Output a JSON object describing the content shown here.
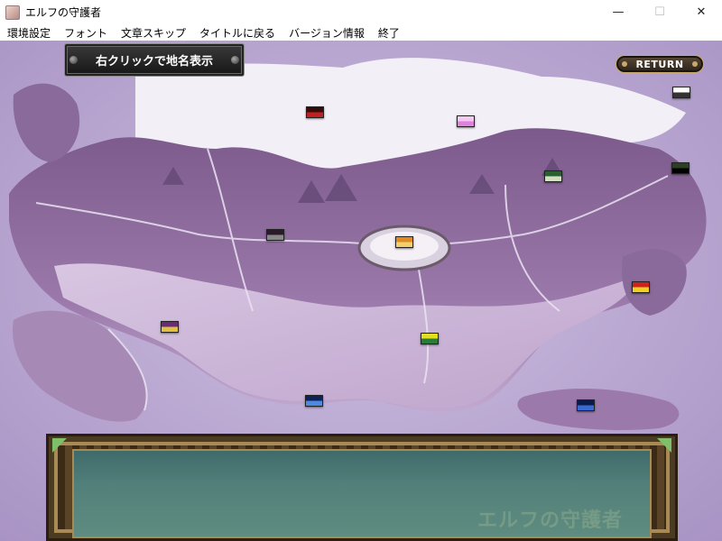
{
  "window": {
    "title": "エルフの守護者",
    "controls": {
      "minimize": "—",
      "maximize": "☐",
      "close": "✕"
    }
  },
  "menu": {
    "items": [
      {
        "label": "環境設定"
      },
      {
        "label": "フォント"
      },
      {
        "label": "文章スキップ"
      },
      {
        "label": "タイトルに戻る"
      },
      {
        "label": "バージョン情報"
      },
      {
        "label": "終了"
      }
    ]
  },
  "map": {
    "hint_label": "右クリックで地名表示",
    "return_label": "RETURN",
    "flags": [
      {
        "name": "flag-north-red",
        "colors": [
          "#3a0a0a",
          "#c02020"
        ]
      },
      {
        "name": "flag-north-pink",
        "colors": [
          "#f4c8f0",
          "#e080e0"
        ]
      },
      {
        "name": "flag-northeast-white",
        "colors": [
          "#ffffff",
          "#333333"
        ]
      },
      {
        "name": "flag-east-green",
        "colors": [
          "#2a6030",
          "#d0e0c0"
        ]
      },
      {
        "name": "flag-east-dark",
        "colors": [
          "#2a4020",
          "#000000"
        ]
      },
      {
        "name": "flag-west-dark",
        "colors": [
          "#2a1a2a",
          "#888888"
        ]
      },
      {
        "name": "flag-center-orange",
        "colors": [
          "#e08a20",
          "#f0d070"
        ]
      },
      {
        "name": "flag-eastcoast-red",
        "colors": [
          "#d02020",
          "#f0d020"
        ]
      },
      {
        "name": "flag-west-purple",
        "colors": [
          "#6a2a7a",
          "#e0c040"
        ]
      },
      {
        "name": "flag-south-yellow",
        "colors": [
          "#e0e020",
          "#2a7a3a"
        ]
      },
      {
        "name": "flag-south-blue",
        "colors": [
          "#10205a",
          "#4a8ae0"
        ]
      },
      {
        "name": "flag-southeast-blue",
        "colors": [
          "#0a1a4a",
          "#3a6ad0"
        ]
      }
    ],
    "colors": {
      "land": "#8e6a9e",
      "snow": "#f2eef6",
      "sea": "#b5a3cd",
      "rivers": "#e6dcef"
    }
  },
  "message_box": {
    "watermark": "エルフの守護者"
  }
}
